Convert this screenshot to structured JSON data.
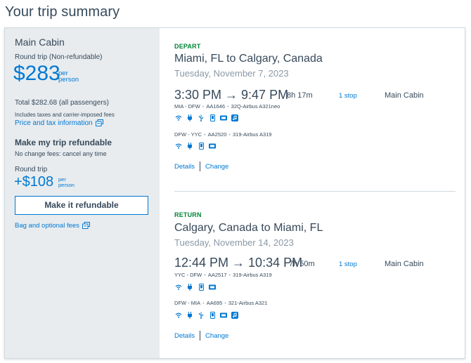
{
  "page": {
    "title": "Your trip summary"
  },
  "summary": {
    "cabin": "Main Cabin",
    "trip_type": "Round trip (Non-refundable)",
    "price": "$283",
    "per": "per",
    "person": "person",
    "total": "Total $282.68 (all passengers)",
    "includes": "Includes taxes and carrier-imposed fees",
    "price_tax_link": "Price and tax information",
    "refundable_title": "Make my trip refundable",
    "no_change_fees": "No change fees: cancel any time",
    "round_trip_label": "Round trip",
    "upsell_price": "+$108",
    "refund_button": "Make it refundable",
    "bag_fees_link": "Bag and optional fees"
  },
  "depart": {
    "label": "DEPART",
    "route": "Miami, FL to Calgary, Canada",
    "date": "Tuesday, November 7, 2023",
    "times": "3:30 PM → 9:47 PM",
    "duration": "8h 17m",
    "stops": "1 stop",
    "cabin": "Main Cabin",
    "segments": [
      {
        "route": "MIA - DFW",
        "flight": "AA1646",
        "aircraft": "32Q-Airbus A321neo"
      },
      {
        "route": "DFW - YYC",
        "flight": "AA2520",
        "aircraft": "319-Airbus A319"
      }
    ],
    "details": "Details",
    "change": "Change"
  },
  "return": {
    "label": "RETURN",
    "route": "Calgary, Canada to Miami, FL",
    "date": "Tuesday, November 14, 2023",
    "times": "12:44 PM → 10:34 PM",
    "duration": "7h 50m",
    "stops": "1 stop",
    "cabin": "Main Cabin",
    "segments": [
      {
        "route": "YYC - DFW",
        "flight": "AA2517",
        "aircraft": "319-Airbus A319"
      },
      {
        "route": "DFW - MIA",
        "flight": "AA695",
        "aircraft": "321-Airbus A321"
      }
    ],
    "details": "Details",
    "change": "Change"
  },
  "colors": {
    "link": "#0078d2",
    "text": "#36495a",
    "depart_green": "#008535",
    "panel": "#e8ecef"
  },
  "icons": [
    "wifi-icon",
    "power-icon",
    "usb-icon",
    "device-icon",
    "tv-icon",
    "entertainment-icon",
    "external-link-icon"
  ]
}
